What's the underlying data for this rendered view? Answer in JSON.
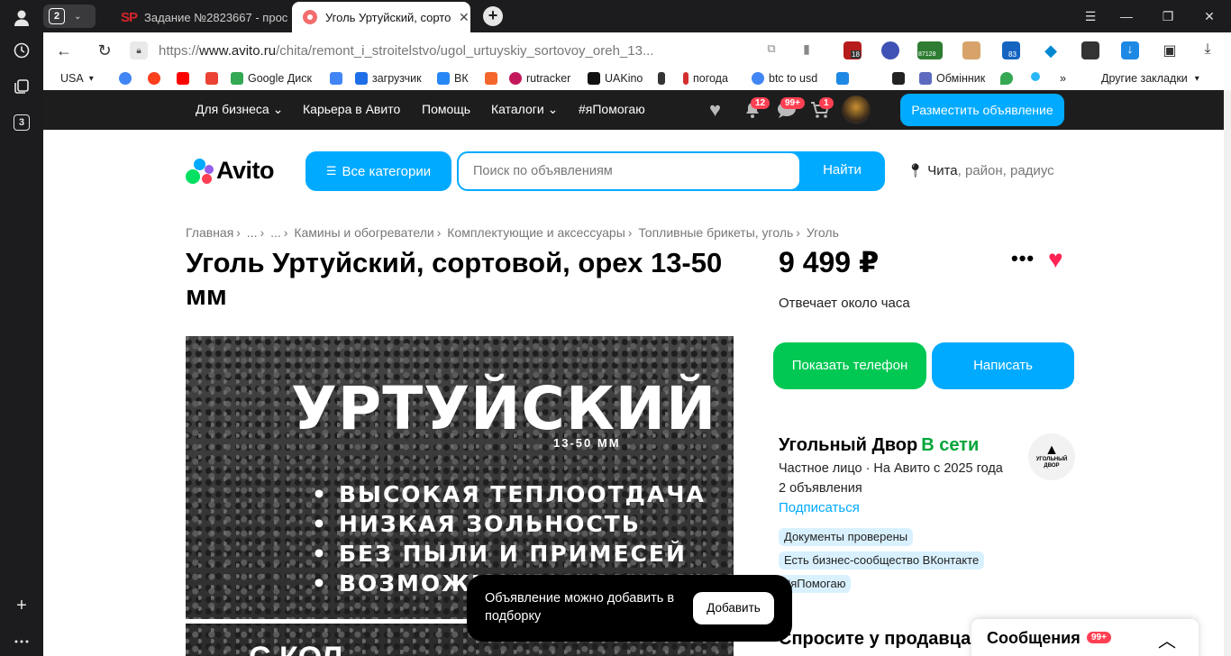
{
  "sidebar": {
    "workspace_badge": "3"
  },
  "tabs": {
    "count": "2",
    "items": [
      {
        "favicon": "SP",
        "title": "Задание №2823667 - прос"
      },
      {
        "title": "Уголь Уртуйский, сорто"
      }
    ]
  },
  "address_bar": {
    "url_prefix": "https://",
    "url_host": "www.avito.ru",
    "url_path": "/chita/remont_i_stroitelstvo/ugol_urtuyskiy_sortovoy_oreh_13...",
    "extension_badges": [
      "18",
      "87128",
      "83"
    ]
  },
  "bookmarks": {
    "items": [
      {
        "label": "USA",
        "color": "#ffffff"
      },
      {
        "label": "",
        "icon": "google-icon",
        "color": "#4285f4"
      },
      {
        "label": "",
        "icon": "yandex-icon",
        "color": "#fc3f1d"
      },
      {
        "label": "",
        "icon": "youtube-icon",
        "color": "#ff0000"
      },
      {
        "label": "",
        "icon": "gmail-icon",
        "color": "#ea4335"
      },
      {
        "label": "Google Диск",
        "icon": "drive-icon",
        "color": "#34a853"
      },
      {
        "label": "",
        "icon": "translate-icon",
        "color": "#4285f4"
      },
      {
        "label": "загрузчик",
        "icon": "infinity-icon",
        "color": "#1e6ee8"
      },
      {
        "label": "ВК",
        "icon": "play-icon",
        "color": "#2787f5"
      },
      {
        "label": "",
        "icon": "f-icon",
        "color": "#f4662b"
      },
      {
        "label": "rutracker",
        "icon": "rutracker-icon",
        "color": "#c2185b"
      },
      {
        "label": "UAKino",
        "icon": "uakino-icon",
        "color": "#111111"
      },
      {
        "label": "",
        "icon": "chess-icon",
        "color": "#333333"
      },
      {
        "label": "погода",
        "icon": "thermometer-icon",
        "color": "#d32f2f"
      },
      {
        "label": "btc to usd",
        "icon": "google-icon",
        "color": "#4285f4"
      },
      {
        "label": "",
        "icon": "p-icon",
        "color": "#1e88e5"
      },
      {
        "label": "",
        "icon": "bc-icon",
        "color": "#222222"
      },
      {
        "label": "Обмінник",
        "icon": "exchange-icon",
        "color": "#5c6bc0"
      },
      {
        "label": "",
        "icon": "maps-icon",
        "color": "#34a853"
      },
      {
        "label": "",
        "icon": "star-icon",
        "color": "#29b6f6"
      },
      {
        "label": "»"
      },
      {
        "label": "Другие закладки"
      }
    ]
  },
  "avito": {
    "topnav": {
      "links": [
        "Для бизнеса",
        "Карьера в Авито",
        "Помощь",
        "Каталоги",
        "#яПомогаю"
      ],
      "notifications_badge": "12",
      "messages_badge": "99+",
      "cart_badge": "1",
      "post_button": "Разместить объявление"
    },
    "logo_text": "Avito",
    "categories_button": "Все категории",
    "search": {
      "placeholder": "Поиск по объявлениям",
      "button": "Найти"
    },
    "location": {
      "city": "Чита",
      "hint": ", район, радиус"
    },
    "breadcrumbs": [
      "Главная",
      "...",
      "...",
      "Камины и обогреватели",
      "Комплектующие и аксессуары",
      "Топливные брикеты, уголь",
      "Уголь"
    ],
    "listing": {
      "title": "Уголь Уртуйский, сортовой, орех 13-50 мм",
      "price": "9 499 ₽",
      "reply_time": "Отвечает около часа",
      "show_phone": "Показать телефон",
      "write": "Написать"
    },
    "photo": {
      "headline": "УРТУЙСКИЙ",
      "size": "13-50 ММ",
      "bullets": [
        "ВЫСОКАЯ ТЕПЛООТДАЧА",
        "НИЗКАЯ ЗОЛЬНОСТЬ",
        "БЕЗ ПЫЛИ И ПРИМЕСЕЙ",
        "ВОЗМОЖНА Д"
      ],
      "bottom_text": "С КОЛ"
    },
    "seller": {
      "name": "Угольный Двор",
      "status": "В сети",
      "type": "Частное лицо · На Авито с 2025 года",
      "ads_count": "2 объявления",
      "subscribe": "Подписаться",
      "logo_text": "УГОЛЬНЫЙ ДВОР",
      "chips": [
        "Документы проверены",
        "Есть бизнес-сообщество ВКонтакте",
        "#яПомогаю"
      ]
    },
    "ask_seller": "Спросите у продавца",
    "toast": {
      "text": "Объявление можно добавить в подборку",
      "button": "Добавить"
    },
    "messages_panel": {
      "label": "Сообщения",
      "badge": "99+"
    }
  }
}
